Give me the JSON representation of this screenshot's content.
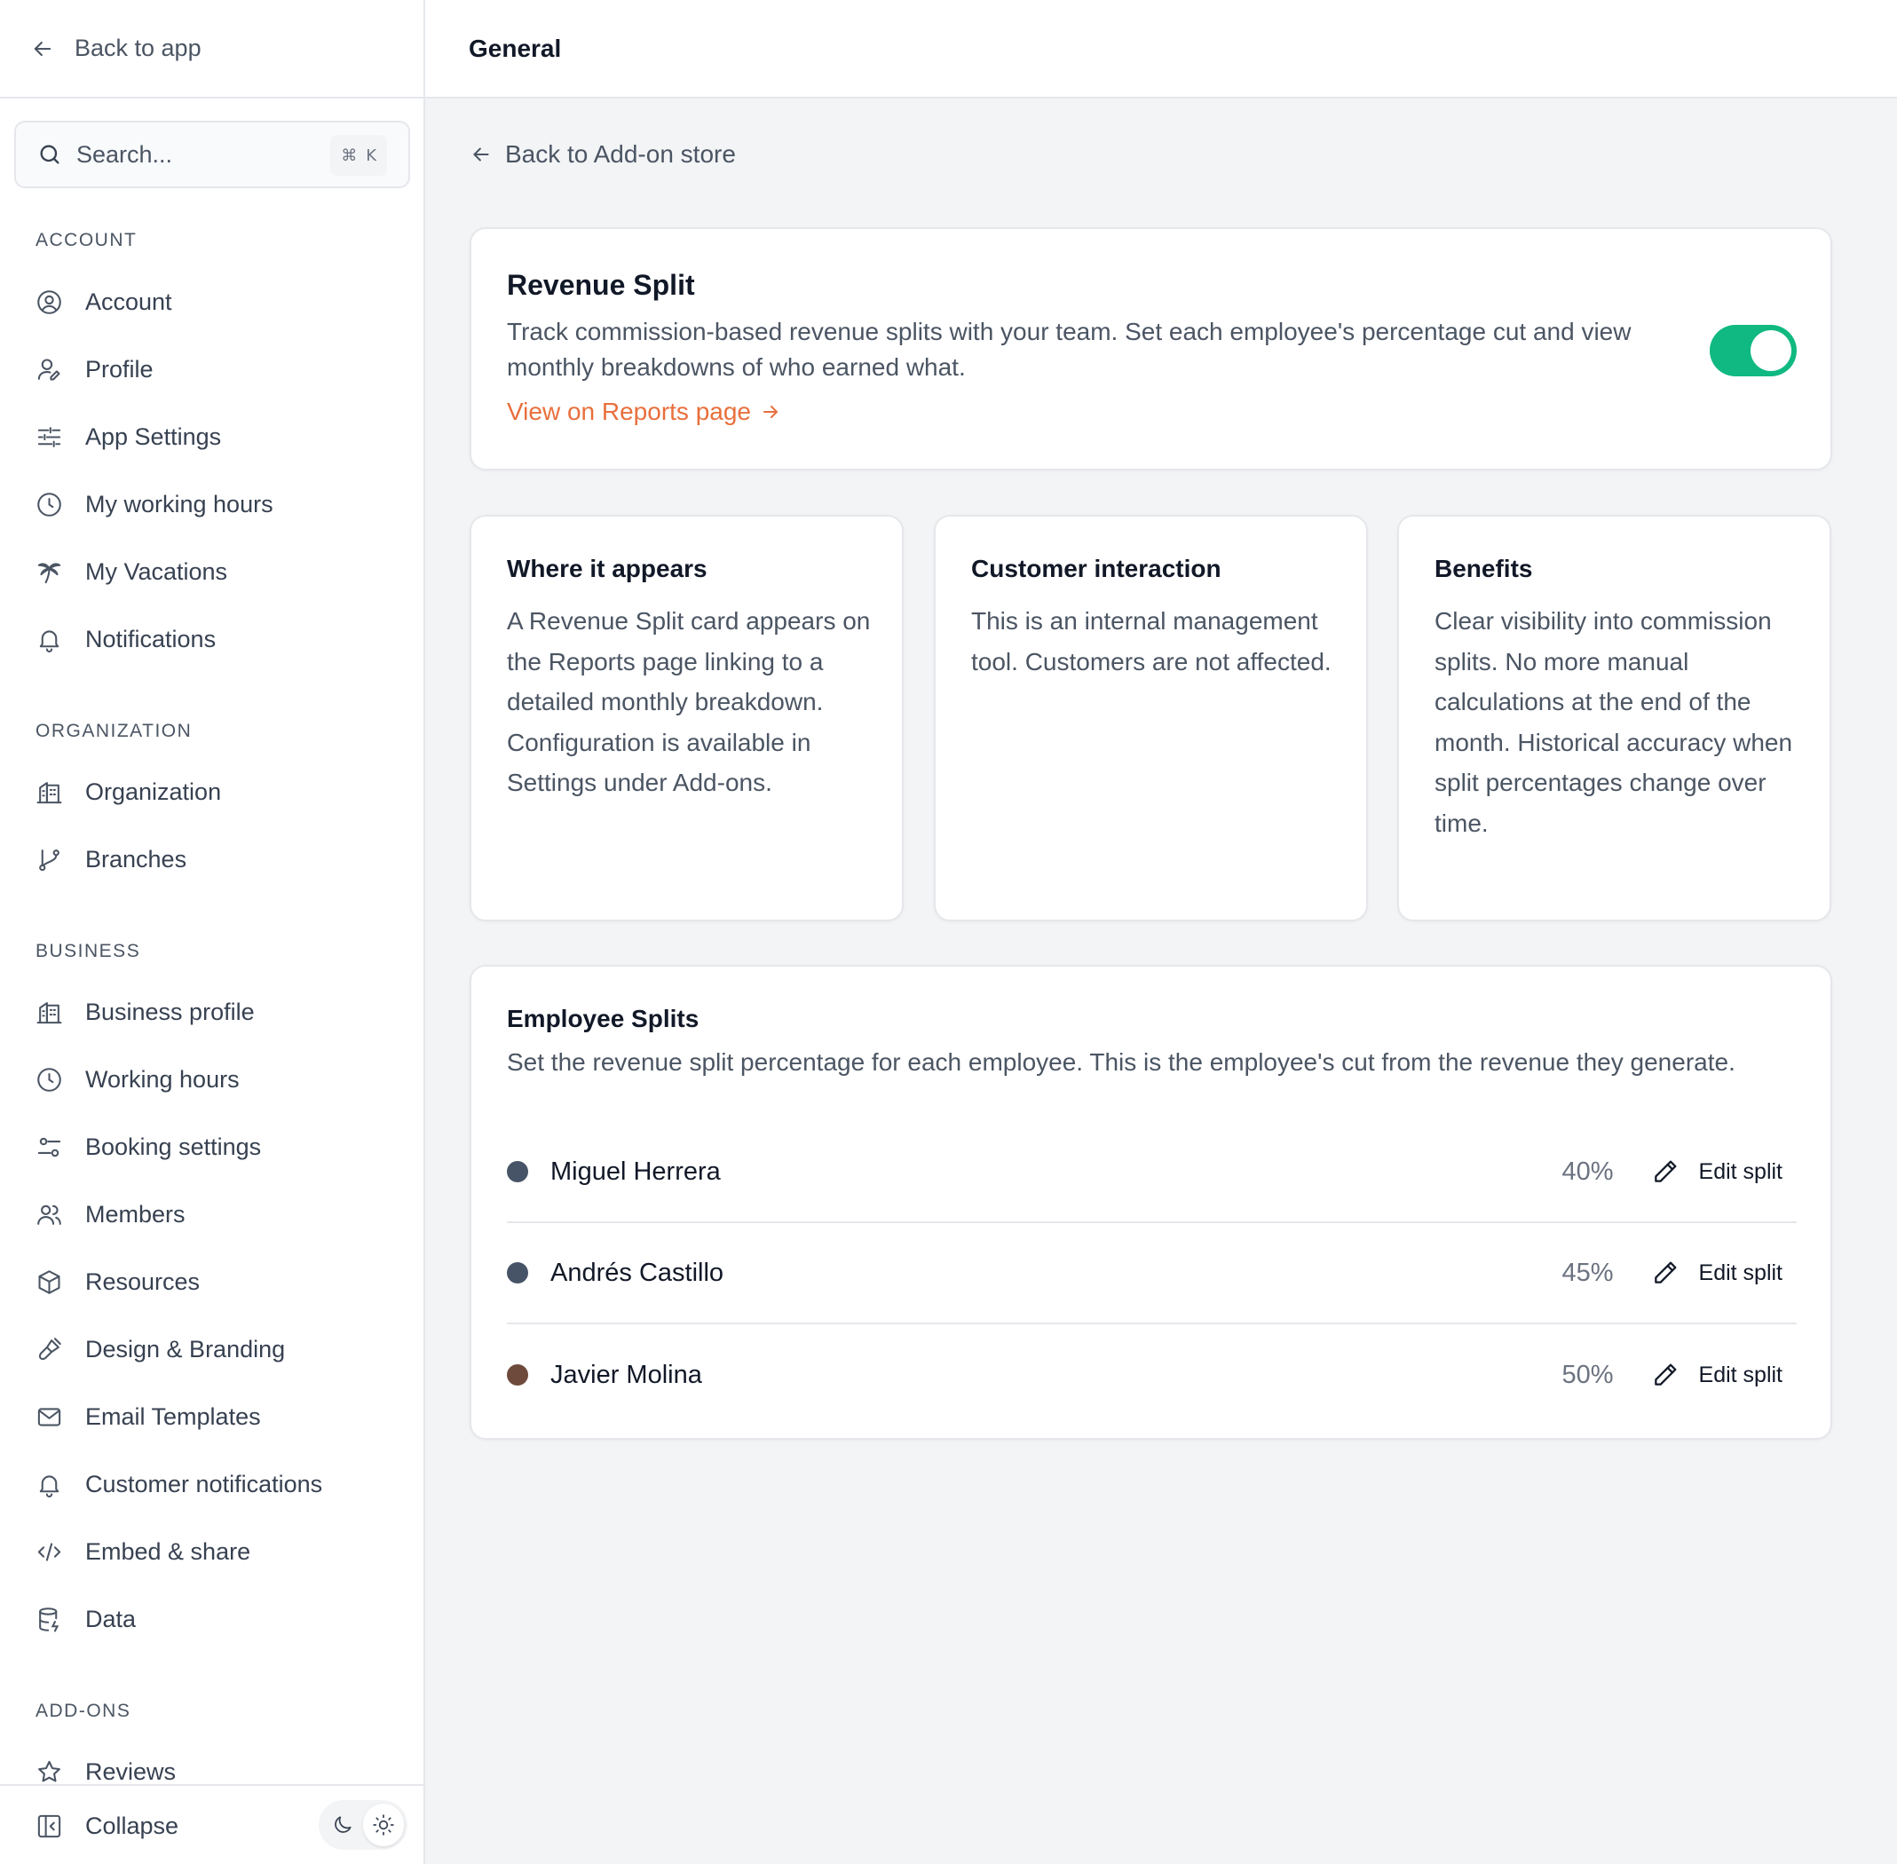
{
  "sidebar": {
    "back_label": "Back to app",
    "search_placeholder": "Search...",
    "search_shortcut_symbol": "⌘",
    "search_shortcut_key": "K",
    "sections": {
      "account": "ACCOUNT",
      "organization": "ORGANIZATION",
      "business": "BUSINESS",
      "addons": "ADD-ONS"
    },
    "items": {
      "account": "Account",
      "profile": "Profile",
      "app_settings": "App Settings",
      "my_working_hours": "My working hours",
      "my_vacations": "My Vacations",
      "notifications": "Notifications",
      "organization": "Organization",
      "branches": "Branches",
      "business_profile": "Business profile",
      "working_hours": "Working hours",
      "booking_settings": "Booking settings",
      "members": "Members",
      "resources": "Resources",
      "design_branding": "Design & Branding",
      "email_templates": "Email Templates",
      "customer_notifications": "Customer notifications",
      "embed_share": "Embed & share",
      "data": "Data",
      "reviews": "Reviews"
    },
    "collapse_label": "Collapse",
    "theme": {
      "active": "light"
    }
  },
  "header": {
    "title": "General"
  },
  "main": {
    "back_store_label": "Back to Add-on store",
    "addon": {
      "title": "Revenue Split",
      "description": "Track commission-based revenue splits with your team. Set each employee's percentage cut and view monthly breakdowns of who earned what.",
      "link_label": "View on Reports page",
      "enabled": true,
      "toggle_color": "#10b981",
      "link_color": "#e86f3c"
    },
    "info_cards": [
      {
        "title": "Where it appears",
        "body": "A Revenue Split card appears on the Reports page linking to a detailed monthly breakdown. Configuration is available in Settings under Add-ons."
      },
      {
        "title": "Customer interaction",
        "body": "This is an internal management tool. Customers are not affected."
      },
      {
        "title": "Benefits",
        "body": "Clear visibility into commission splits. No more manual calculations at the end of the month. Historical accuracy when split percentages change over time."
      }
    ],
    "splits": {
      "title": "Employee Splits",
      "description": "Set the revenue split percentage for each employee. This is the employee's cut from the revenue they generate.",
      "edit_label": "Edit split",
      "employees": [
        {
          "name": "Miguel Herrera",
          "percent": "40%",
          "color": "#475467"
        },
        {
          "name": "Andrés Castillo",
          "percent": "45%",
          "color": "#475467"
        },
        {
          "name": "Javier Molina",
          "percent": "50%",
          "color": "#6e4a3c"
        }
      ]
    }
  }
}
